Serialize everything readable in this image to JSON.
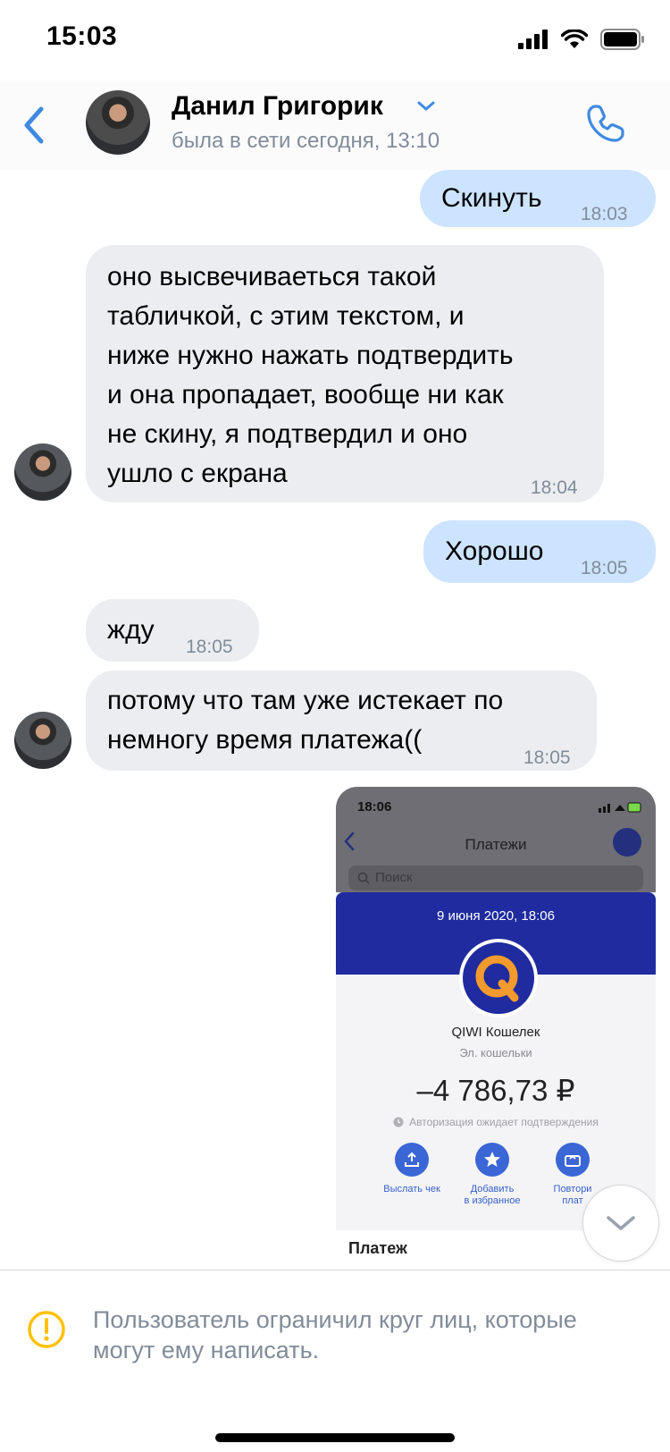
{
  "status_bar": {
    "time": "15:03"
  },
  "header": {
    "name": "Данил Григорик",
    "status": "была в сети сегодня, 13:10"
  },
  "messages": [
    {
      "dir": "out",
      "text": "Скинуть",
      "time": "18:03"
    },
    {
      "dir": "in",
      "text": "оно высвечиваеться такой\nтабличкой, с этим текстом, и\nниже нужно нажать подтвердить\nи она пропадает, вообще ни как\nне скину, я подтвердил и оно\nушло с екрана",
      "time": "18:04"
    },
    {
      "dir": "out",
      "text": "Хорошо",
      "time": "18:05"
    },
    {
      "dir": "in",
      "text": "жду",
      "time": "18:05"
    },
    {
      "dir": "in",
      "text": "потому что там уже истекает по\nнемногу время платежа((",
      "time": "18:05"
    }
  ],
  "photo": {
    "time": "18:06",
    "screen_title": "Платежи",
    "search_placeholder": "Поиск",
    "date": "9 июня 2020, 18:06",
    "merchant": "QIWI Кошелек",
    "category": "Эл. кошельки",
    "amount": "–4 786,73 ₽",
    "note": "Авторизация ожидает подтверждения",
    "actions": [
      "Выслать чек",
      "Добавить\nв избранное",
      "Повтори\nплат"
    ],
    "section": "Платеж"
  },
  "footer": {
    "notice": "Пользователь ограничил круг лиц, которые могут ему написать."
  },
  "colors": {
    "accent": "#3f8ae0",
    "incoming": "#ebedf0",
    "outgoing": "#cce4ff",
    "warning": "#ffc107",
    "secondary": "#818c99"
  }
}
